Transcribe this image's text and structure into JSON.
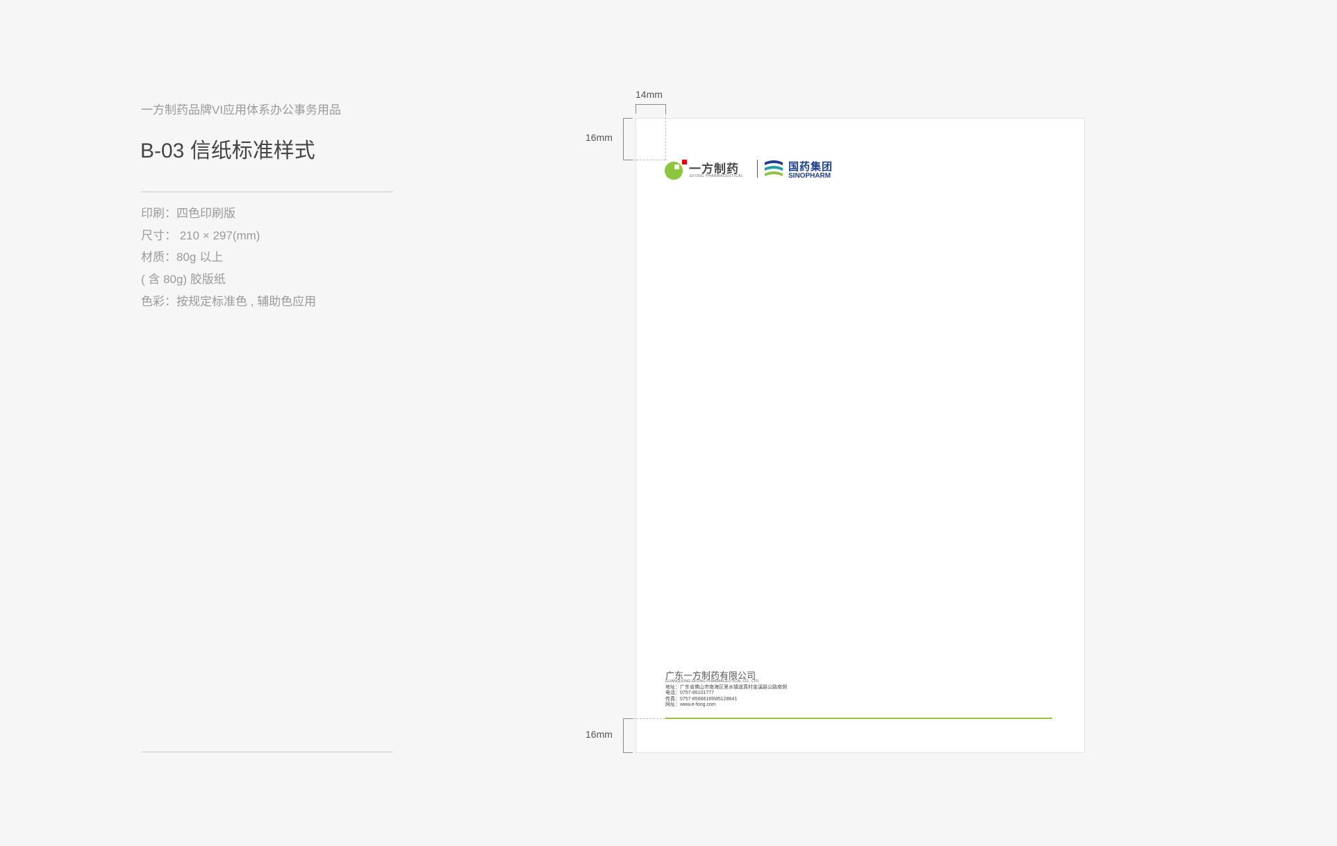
{
  "panel": {
    "subtitle": "一方制药品牌VI应用体系办公事务用品",
    "title": "B-03 信纸标准样式",
    "specs": [
      "印刷：四色印刷版",
      "尺寸： 210 × 297(mm)",
      "材质：80g 以上",
      "( 含 80g) 胶版纸",
      "色彩：按规定标准色 , 辅助色应用"
    ]
  },
  "dimensions": {
    "left_margin": "14mm",
    "top_margin": "16mm",
    "bottom_margin": "16mm"
  },
  "letterhead": {
    "brand_cn": "一方制药",
    "brand_en": "EFONG PHARMACEUTICAL",
    "partner_cn": "国药集团",
    "partner_en": "SINOPHARM",
    "company_cn": "广东一方制药有限公司",
    "company_en": "GUANGDONG EFONG PHARMACEUTICAL CO., LTD.",
    "contact": [
      "地址：广东省佛山市南海区里水镇道真村金溪路公路南侧",
      "电话：0757-85101777",
      "传真：0757-85666169\\85128641",
      "网址：www.e-fong.com"
    ]
  },
  "colors": {
    "brand_green": "#8cc63f",
    "brand_red": "#e60012",
    "sinopharm_blue": "#1d3f8e",
    "sinopharm_teal": "#1aa0a0"
  }
}
